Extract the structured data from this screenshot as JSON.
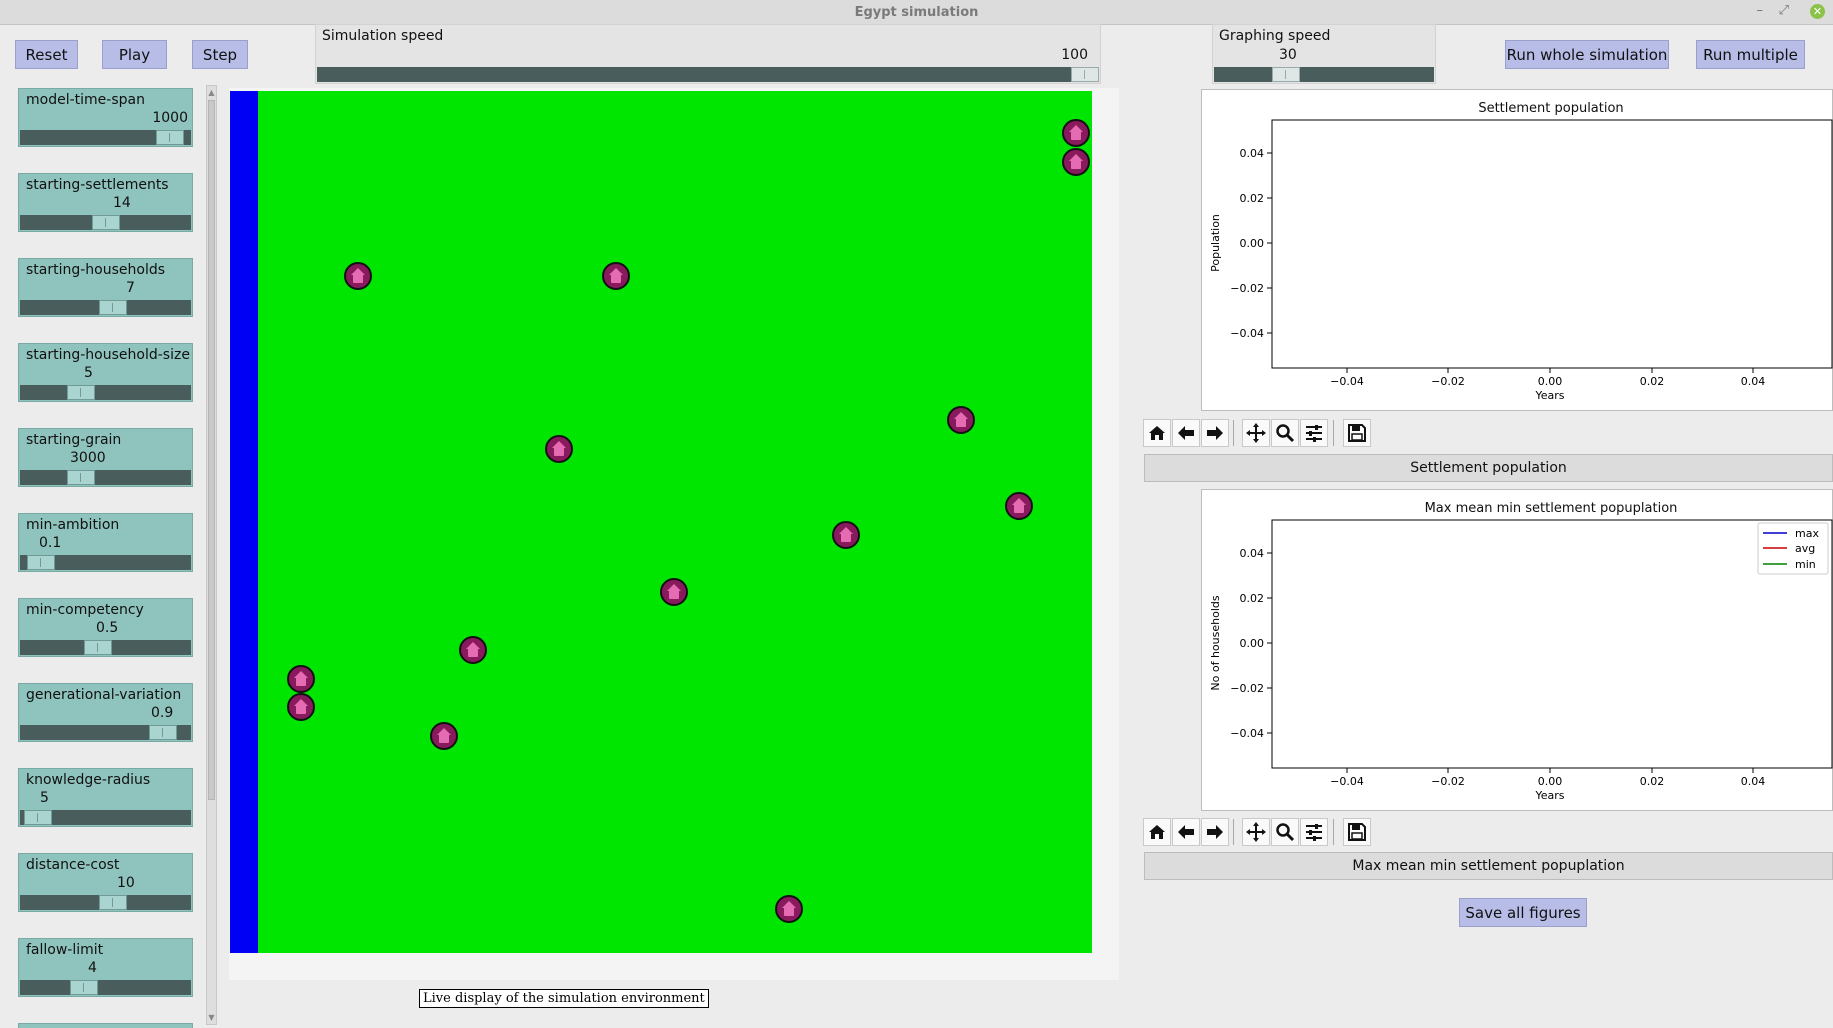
{
  "window": {
    "title": "Egypt simulation"
  },
  "buttons": {
    "reset": "Reset",
    "play": "Play",
    "step": "Step",
    "run_whole": "Run whole simulation",
    "run_multiple": "Run multiple",
    "save_all": "Save all figures"
  },
  "simulation_speed": {
    "label": "Simulation speed",
    "value": "100",
    "fraction": 1.0
  },
  "graphing_speed": {
    "label": "Graphing speed",
    "value": "30",
    "fraction": 0.3
  },
  "parameters": [
    {
      "label": "model-time-span",
      "value": "1000",
      "fraction": 0.95
    },
    {
      "label": "starting-settlements",
      "value": "14",
      "fraction": 0.5
    },
    {
      "label": "starting-households",
      "value": "7",
      "fraction": 0.55
    },
    {
      "label": "starting-household-size",
      "value": "5",
      "fraction": 0.33
    },
    {
      "label": "starting-grain",
      "value": "3000",
      "fraction": 0.33
    },
    {
      "label": "min-ambition",
      "value": "0.1",
      "fraction": 0.05
    },
    {
      "label": "min-competency",
      "value": "0.5",
      "fraction": 0.45
    },
    {
      "label": "generational-variation",
      "value": "0.9",
      "fraction": 0.9
    },
    {
      "label": "knowledge-radius",
      "value": "5",
      "fraction": 0.03
    },
    {
      "label": "distance-cost",
      "value": "10",
      "fraction": 0.55
    },
    {
      "label": "fallow-limit",
      "value": "4",
      "fraction": 0.35
    }
  ],
  "environment": {
    "tooltip": "Live display of the simulation environment",
    "colors": {
      "land": "#00e600",
      "river": "#0000f5",
      "settlement": "#8a1a5e"
    }
  },
  "plot1": {
    "title": "Settlement population",
    "panel_label": "Settlement population",
    "xlabel": "Years",
    "ylabel": "Population",
    "xticks": [
      "−0.04",
      "−0.02",
      "0.00",
      "0.02",
      "0.04"
    ],
    "yticks": [
      "0.04",
      "0.02",
      "0.00",
      "−0.02",
      "−0.04"
    ]
  },
  "plot2": {
    "title": "Max mean min settlement popuplation",
    "panel_label": "Max mean min settlement popuplation",
    "xlabel": "Years",
    "ylabel": "No of households",
    "xticks": [
      "−0.04",
      "−0.02",
      "0.00",
      "0.02",
      "0.04"
    ],
    "yticks": [
      "0.04",
      "0.02",
      "0.00",
      "−0.02",
      "−0.04"
    ],
    "legend": [
      {
        "name": "max",
        "color": "#0000cc"
      },
      {
        "name": "avg",
        "color": "#cc0000"
      },
      {
        "name": "min",
        "color": "#008000"
      }
    ]
  },
  "toolbar_icons": [
    "home-icon",
    "back-arrow-icon",
    "forward-arrow-icon",
    "pan-icon",
    "zoom-icon",
    "configure-subplots-icon",
    "save-icon"
  ]
}
